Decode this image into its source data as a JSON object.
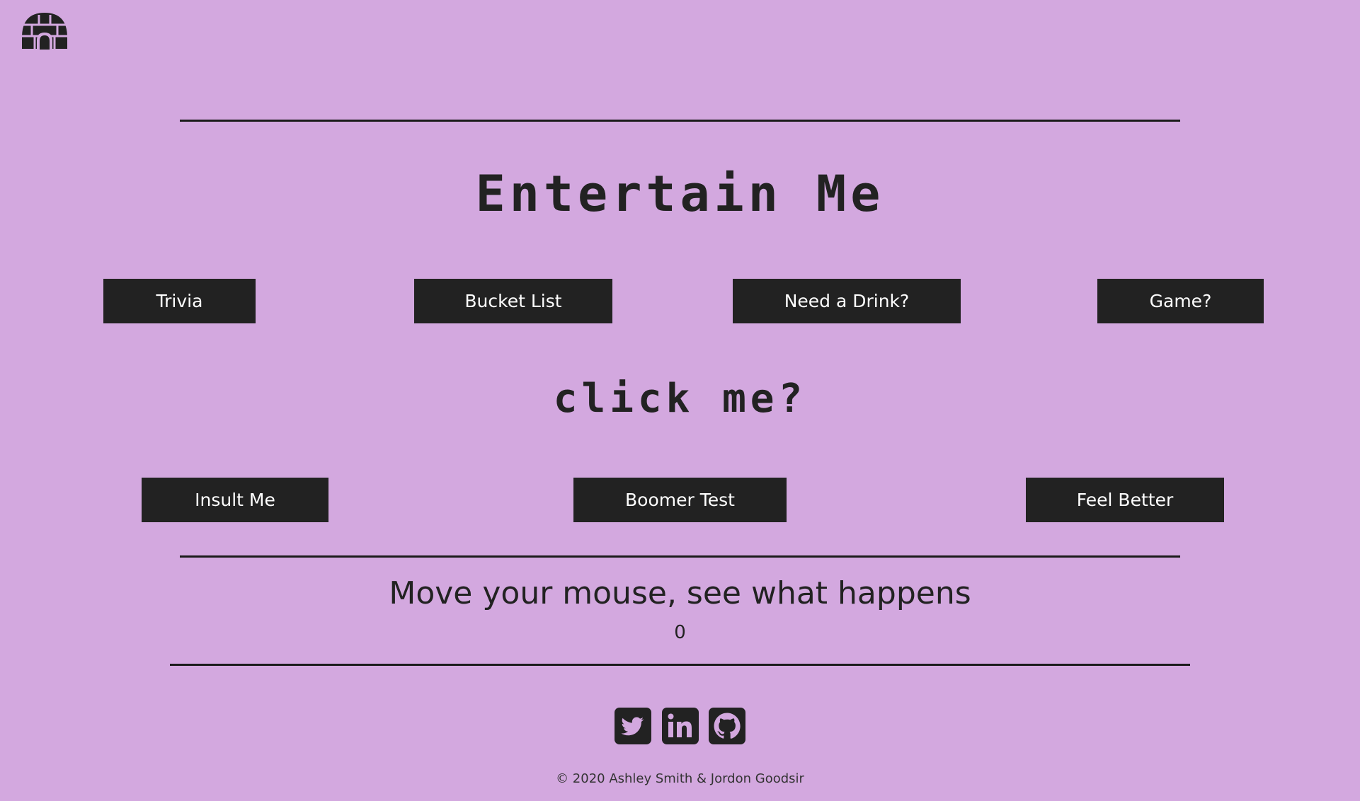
{
  "header": {
    "logo_icon": "igloo-icon"
  },
  "main": {
    "title": "Entertain Me",
    "buttons_row1": [
      {
        "label": "Trivia"
      },
      {
        "label": "Bucket List"
      },
      {
        "label": "Need a Drink?"
      },
      {
        "label": "Game?"
      }
    ],
    "subtitle": "click me?",
    "buttons_row2": [
      {
        "label": "Insult Me"
      },
      {
        "label": "Boomer Test"
      },
      {
        "label": "Feel Better"
      }
    ]
  },
  "mouse_section": {
    "heading": "Move your mouse, see what happens",
    "count": "0"
  },
  "footer": {
    "social_icons": [
      "twitter-icon",
      "linkedin-icon",
      "github-icon"
    ],
    "copyright": "© 2020 Ashley Smith & Jordon Goodsir"
  },
  "colors": {
    "background": "#d3a8df",
    "dark": "#222222",
    "button_text": "#ffffff"
  }
}
